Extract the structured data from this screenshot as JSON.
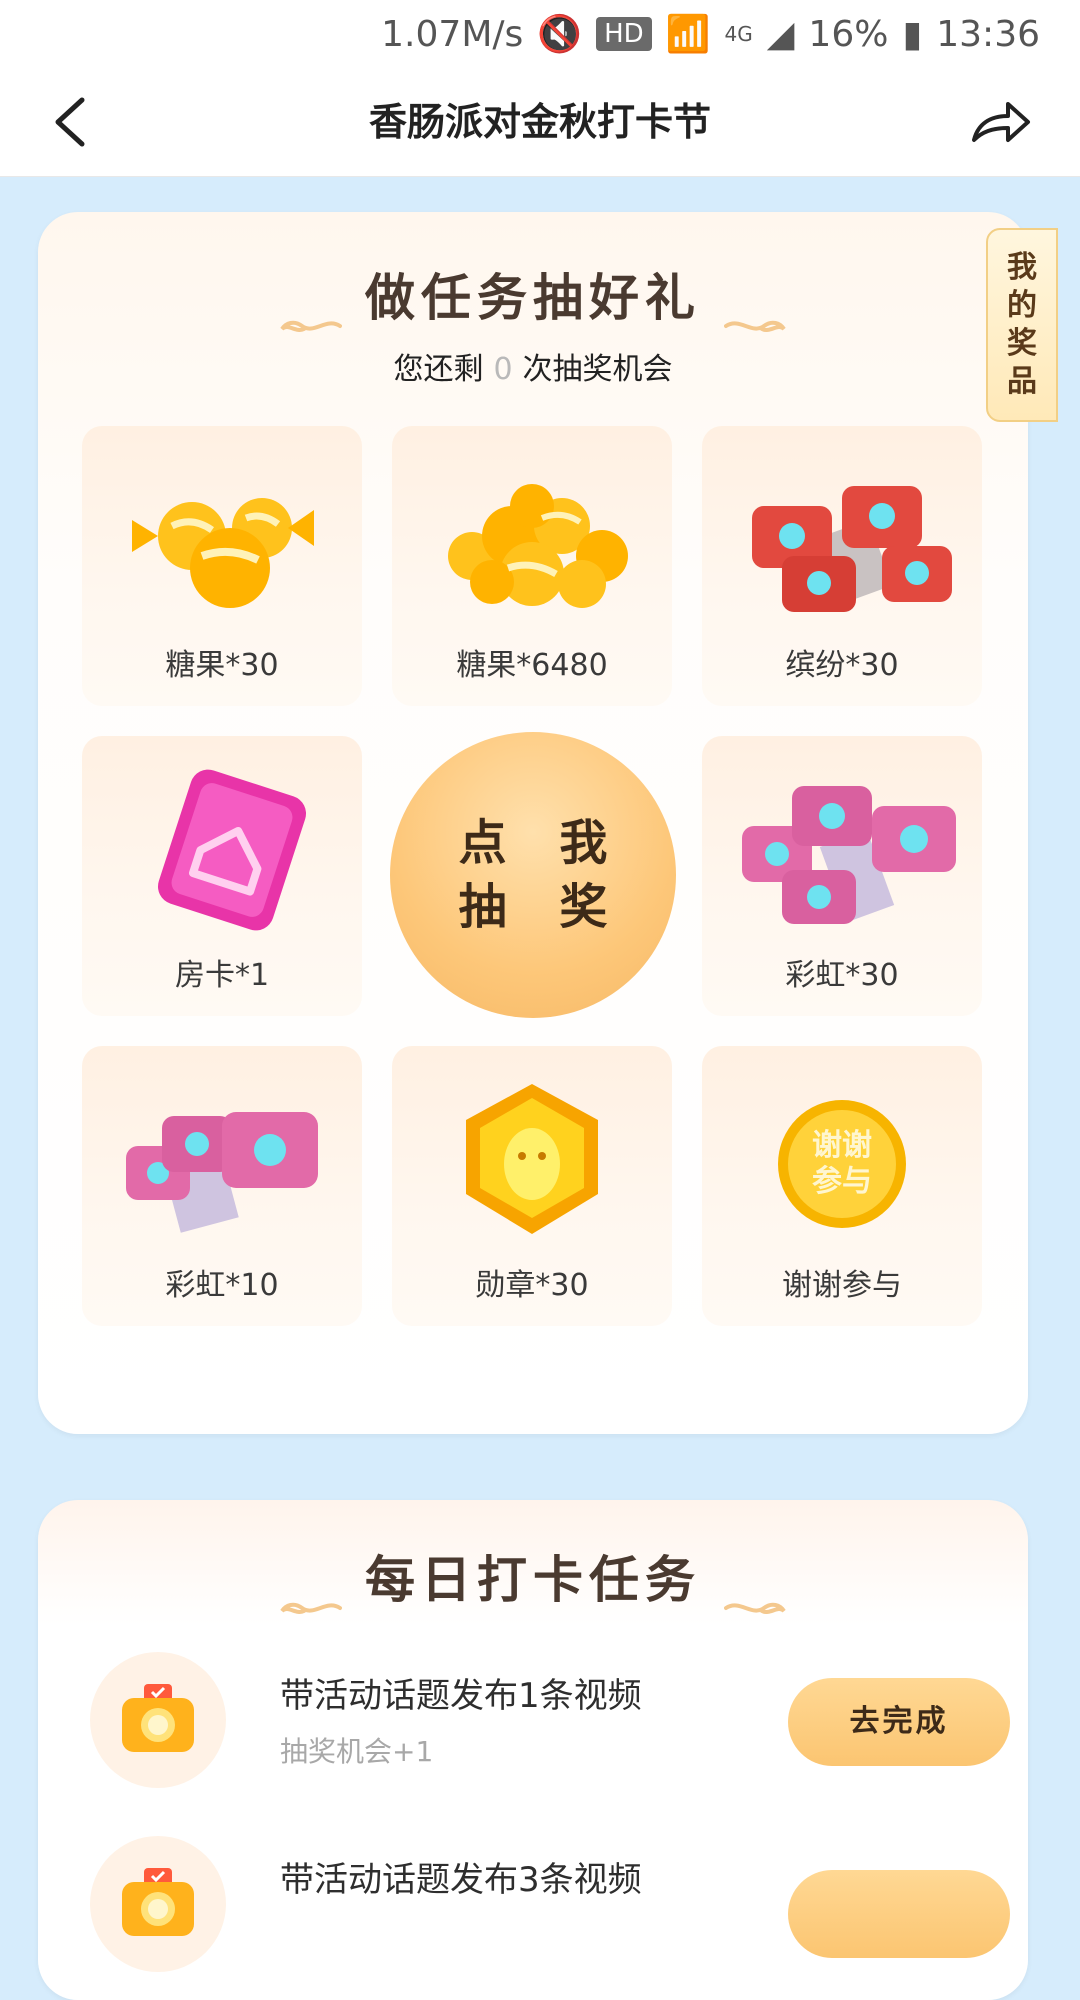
{
  "status_bar": {
    "speed": "1.07M/s",
    "hd": "HD",
    "network": "4G",
    "battery": "16%",
    "time": "13:36"
  },
  "nav": {
    "title": "香肠派对金秋打卡节",
    "back_icon": "chevron-left-icon",
    "share_icon": "share-arrow-icon"
  },
  "lottery": {
    "heading": "做任务抽好礼",
    "chances_prefix": "您还剩",
    "chances_count": "0",
    "chances_suffix": "次抽奖机会",
    "my_prizes": [
      "我",
      "的",
      "奖",
      "品"
    ],
    "draw_button": [
      "点 我",
      "抽 奖"
    ],
    "prizes": [
      {
        "label": "糖果*30",
        "icon": "candy-icon"
      },
      {
        "label": "糖果*6480",
        "icon": "candy-pile-icon"
      },
      {
        "label": "缤纷*30",
        "icon": "red-chip-icon"
      },
      {
        "label": "房卡*1",
        "icon": "room-card-icon"
      },
      {
        "label": "彩虹*30",
        "icon": "rainbow-chip-pile-icon"
      },
      {
        "label": "彩虹*10",
        "icon": "rainbow-chip-icon"
      },
      {
        "label": "勋章*30",
        "icon": "medal-icon"
      },
      {
        "label": "谢谢参与",
        "icon": "thanks-coin-icon",
        "coin_text": [
          "谢谢",
          "参与"
        ]
      }
    ]
  },
  "tasks": {
    "heading": "每日打卡任务",
    "items": [
      {
        "title": "带活动话题发布1条视频",
        "reward": "抽奖机会+1",
        "button": "去完成",
        "icon": "camera-icon"
      },
      {
        "title": "带活动话题发布3条视频",
        "icon": "camera-icon"
      }
    ]
  },
  "colors": {
    "page_bg": "#d6ecfc",
    "accent": "#fbc571",
    "heading_text": "#4a3a30"
  }
}
